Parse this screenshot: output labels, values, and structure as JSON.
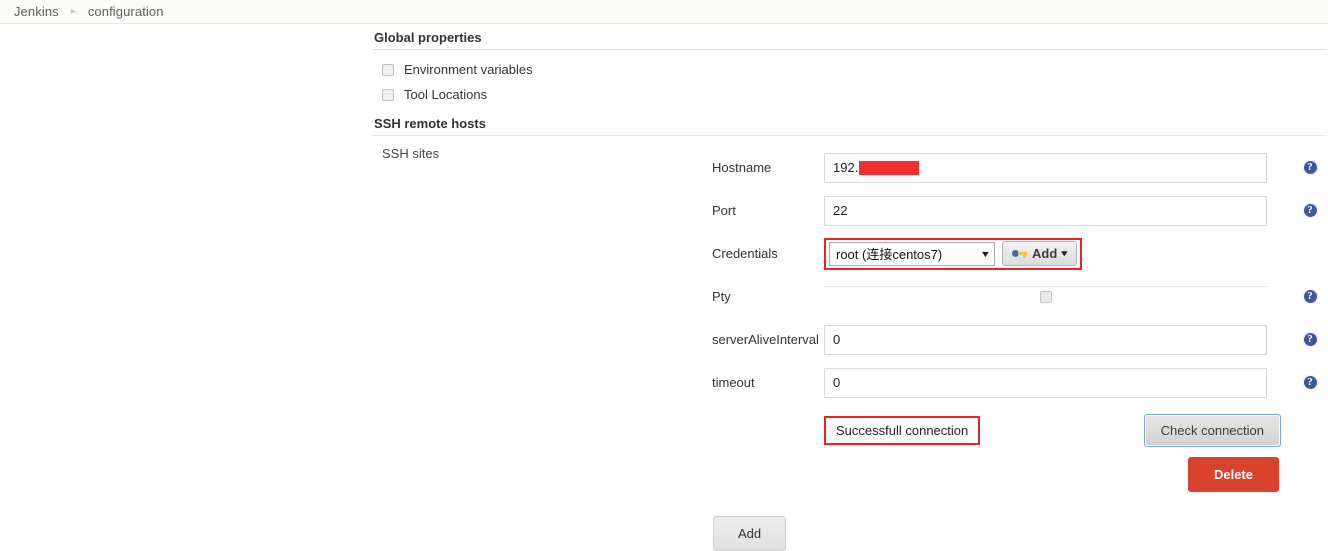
{
  "breadcrumb": {
    "items": [
      {
        "label": "Jenkins"
      },
      {
        "label": "configuration"
      }
    ],
    "separator": "▸"
  },
  "sections": {
    "global_properties": {
      "heading": "Global properties",
      "checkboxes": [
        {
          "label": "Environment variables",
          "checked": false
        },
        {
          "label": "Tool Locations",
          "checked": false
        }
      ]
    },
    "ssh_remote_hosts": {
      "heading": "SSH remote hosts",
      "sites_label": "SSH sites"
    }
  },
  "fields": {
    "hostname": {
      "label": "Hostname",
      "value": "192.",
      "redacted": true,
      "help": "?"
    },
    "port": {
      "label": "Port",
      "value": "22",
      "help": "?"
    },
    "credentials": {
      "label": "Credentials",
      "selected": "root (连接centos7)",
      "caret": "▼",
      "add_label": "Add",
      "add_caret": "▾",
      "highlight_color": "#ee2222"
    },
    "pty": {
      "label": "Pty",
      "checked": false,
      "help": "?"
    },
    "server_alive_interval": {
      "label": "serverAliveInterval",
      "value": "0",
      "help": "?"
    },
    "timeout": {
      "label": "timeout",
      "value": "0",
      "help": "?"
    }
  },
  "status": {
    "message": "Successfull connection",
    "border_color": "#ee2222"
  },
  "buttons": {
    "check_connection": "Check connection",
    "delete": "Delete",
    "add": "Add"
  },
  "colors": {
    "redaction": "#f23030",
    "delete_bg": "#d9422c",
    "help_icon": "#3b5a96",
    "breadcrumb_bg": "#fbfbf8"
  }
}
